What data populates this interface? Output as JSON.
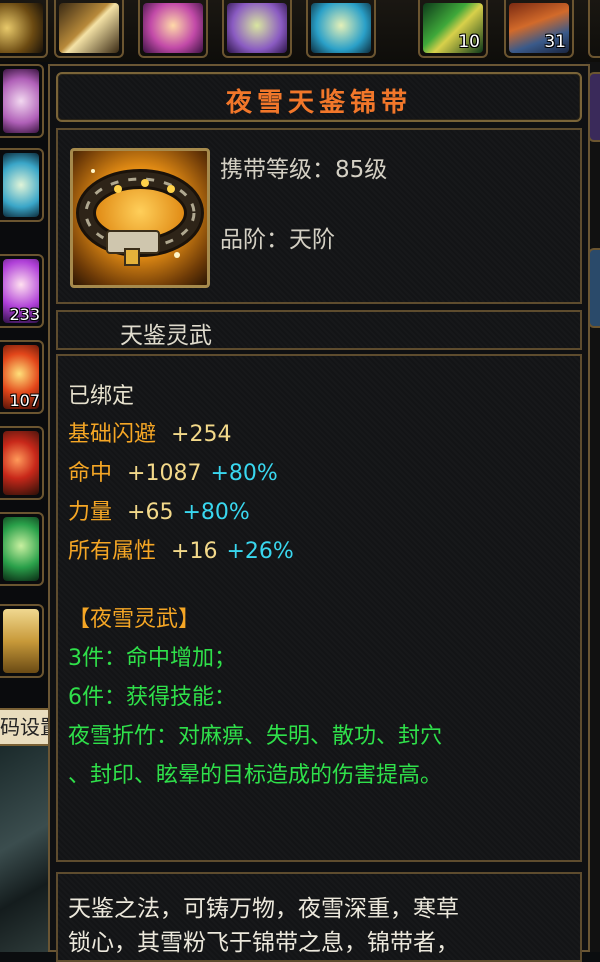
{
  "hotbar_top": [
    {
      "icon": "ring-icon"
    },
    {
      "icon": "sword-icon"
    },
    {
      "icon": "pet-girl-icon"
    },
    {
      "icon": "leaf-spirit-icon"
    },
    {
      "icon": "cat-spirit-icon"
    },
    {
      "icon": "feather-icon",
      "count": "10"
    },
    {
      "icon": "robe-icon",
      "count": "31"
    }
  ],
  "hotbar_left": [
    {
      "icon": "spirit-icon"
    },
    {
      "icon": "cat-icon"
    },
    {
      "icon": "fairy-icon",
      "count": "233"
    },
    {
      "icon": "fire-icon",
      "count": "107"
    },
    {
      "icon": "orb-icon"
    },
    {
      "icon": "green-dragon-icon"
    },
    {
      "icon": "chest-icon"
    }
  ],
  "left_button_label": "码设置",
  "item": {
    "name": "夜雪天鉴锦带",
    "icon": "belt-icon",
    "carry_level": "携带等级：85级",
    "grade": "品阶：天阶",
    "series": "天鉴灵武",
    "bound": "已绑定",
    "stats": [
      {
        "label": "基础闪避",
        "value": "+254",
        "bonus": ""
      },
      {
        "label": "命中",
        "value": "+1087",
        "bonus": "+80%"
      },
      {
        "label": "力量",
        "value": "+65",
        "bonus": "+80%"
      },
      {
        "label": "所有属性",
        "value": "+16",
        "bonus": "+26%"
      }
    ],
    "set_name": "【夜雪灵武】",
    "set_bonus": [
      "3件：命中增加；",
      "6件：获得技能：",
      "夜雪折竹：对麻痹、失明、散功、封穴",
      "、封印、眩晕的目标造成的伤害提高。"
    ],
    "description_lines": [
      "天鉴之法，可铸万物，夜雪深重，寒草",
      "锁心，其雪粉飞于锦带之息，锦带者，"
    ]
  },
  "colors": {
    "title": "#f2772a",
    "stat_value": "#f3d98a",
    "stat_bonus": "#39d7ef",
    "set_bonus": "#2fe04a",
    "set_name": "#f5a625"
  }
}
